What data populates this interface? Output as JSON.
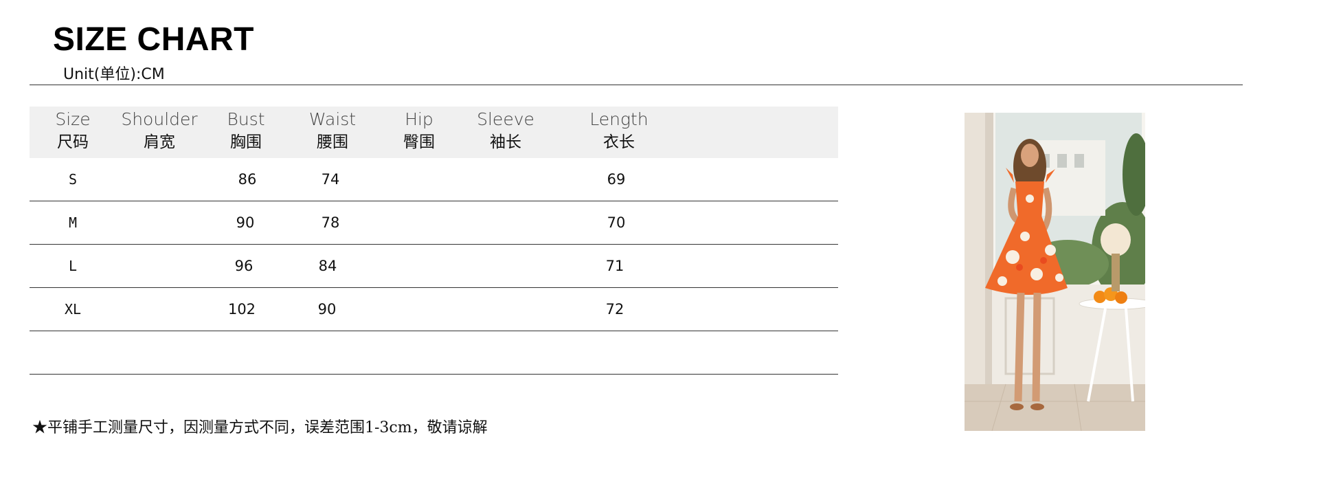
{
  "title": "SIZE CHART",
  "unit": "Unit(单位):CM",
  "columns": [
    {
      "en": "Size",
      "zh": "尺码"
    },
    {
      "en": "Shoulder",
      "zh": "肩宽"
    },
    {
      "en": "Bust",
      "zh": "胸围"
    },
    {
      "en": "Waist",
      "zh": "腰围"
    },
    {
      "en": "Hip",
      "zh": "臀围"
    },
    {
      "en": "Sleeve",
      "zh": "袖长"
    },
    {
      "en": "Length",
      "zh": "衣长"
    }
  ],
  "rows": [
    {
      "size": "S",
      "shoulder": "",
      "bust": "86",
      "waist": "74",
      "hip": "",
      "sleeve": "",
      "length": "69"
    },
    {
      "size": "M",
      "shoulder": "",
      "bust": "90",
      "waist": "78",
      "hip": "",
      "sleeve": "",
      "length": "70"
    },
    {
      "size": "L",
      "shoulder": "",
      "bust": "96",
      "waist": "84",
      "hip": "",
      "sleeve": "",
      "length": "71"
    },
    {
      "size": "XL",
      "shoulder": "",
      "bust": "102",
      "waist": "90",
      "hip": "",
      "sleeve": "",
      "length": "72"
    },
    {
      "size": "",
      "shoulder": "",
      "bust": "",
      "waist": "",
      "hip": "",
      "sleeve": "",
      "length": ""
    }
  ],
  "note": "★平铺手工测量尺寸，因测量方式不同，误差范围1-3cm，敬请谅解",
  "colors": {
    "header_bg": "#f0f0f0",
    "rule": "#333333",
    "dress_orange": "#f06a2a",
    "dress_cream": "#f8efe2"
  }
}
